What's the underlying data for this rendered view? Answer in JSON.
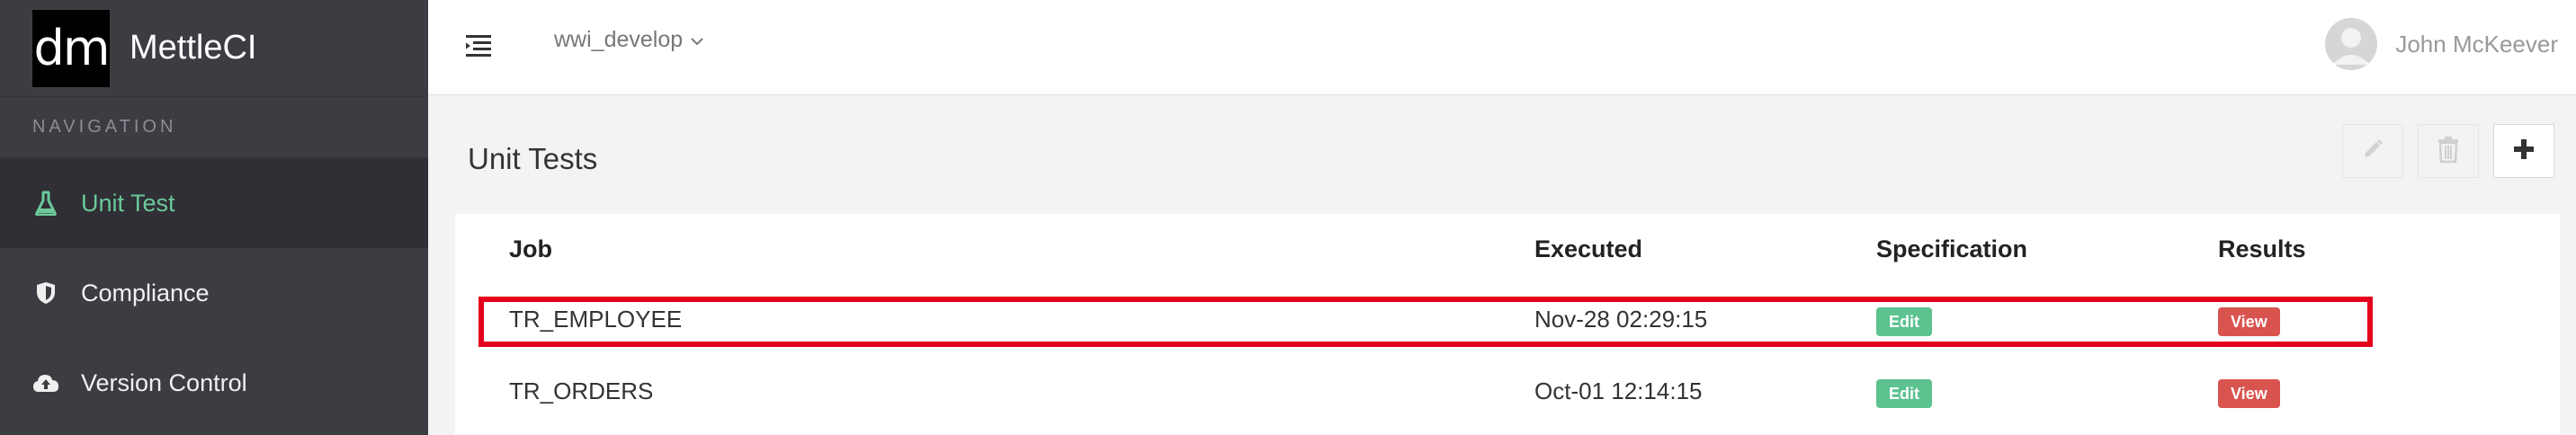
{
  "brand": {
    "logo_text": "dm",
    "name": "MettleCI"
  },
  "sidebar": {
    "heading": "NAVIGATION",
    "items": [
      {
        "label": "Unit Test",
        "icon": "flask-icon",
        "active": true
      },
      {
        "label": "Compliance",
        "icon": "shield-icon",
        "active": false
      },
      {
        "label": "Version Control",
        "icon": "cloud-upload-icon",
        "active": false
      }
    ]
  },
  "topbar": {
    "branch": "wwi_develop",
    "user_name": "John McKeever"
  },
  "page": {
    "title": "Unit Tests",
    "toolbar": [
      {
        "name": "edit-button",
        "icon": "pencil-icon"
      },
      {
        "name": "delete-button",
        "icon": "trash-icon"
      },
      {
        "name": "add-button",
        "icon": "plus-icon"
      }
    ]
  },
  "table": {
    "columns": [
      "Job",
      "Executed",
      "Specification",
      "Results"
    ],
    "rows": [
      {
        "job": "TR_EMPLOYEE",
        "executed": "Nov-28 02:29:15",
        "spec": "Edit",
        "results": "View"
      },
      {
        "job": "TR_ORDERS",
        "executed": "Oct-01 12:14:15",
        "spec": "Edit",
        "results": "View"
      }
    ]
  },
  "colors": {
    "accent_green": "#5cc290",
    "danger_red": "#d9534f",
    "highlight": "#e4001c",
    "sidebar_bg": "#3c3c43"
  }
}
